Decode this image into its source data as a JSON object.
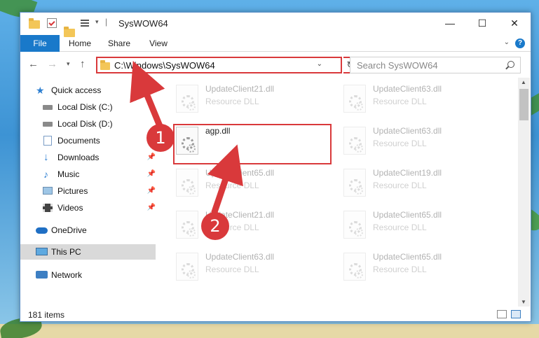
{
  "window": {
    "title": "SysWOW64"
  },
  "window_controls": {
    "minimize": "—",
    "maximize": "☐",
    "close": "✕"
  },
  "ribbon": {
    "tabs": [
      {
        "label": "File",
        "active": true
      },
      {
        "label": "Home"
      },
      {
        "label": "Share"
      },
      {
        "label": "View"
      }
    ],
    "help": "?"
  },
  "address_bar": {
    "path": "C:\\Windows\\SysWOW64",
    "refresh": "↻"
  },
  "search": {
    "placeholder": "Search SysWOW64"
  },
  "sidebar": {
    "items": [
      {
        "label": "Quick access",
        "icon": "star-icon"
      },
      {
        "label": "Local Disk (C:)",
        "icon": "drive-icon"
      },
      {
        "label": "Local Disk (D:)",
        "icon": "drive-icon"
      },
      {
        "label": "Documents",
        "icon": "documents-icon",
        "pinned": true
      },
      {
        "label": "Downloads",
        "icon": "download-icon",
        "pinned": true
      },
      {
        "label": "Music",
        "icon": "music-icon",
        "pinned": true
      },
      {
        "label": "Pictures",
        "icon": "pictures-icon",
        "pinned": true
      },
      {
        "label": "Videos",
        "icon": "videos-icon",
        "pinned": true
      },
      {
        "label": "OneDrive",
        "icon": "cloud-icon"
      },
      {
        "label": "This PC",
        "icon": "computer-icon",
        "selected": true
      },
      {
        "label": "Network",
        "icon": "network-icon"
      }
    ]
  },
  "files": {
    "left": [
      {
        "name": "UpdateClient21.dll",
        "type": "Resource DLL"
      },
      {
        "name": "agp.dll",
        "type": ""
      },
      {
        "name": "UpdateClient65.dll",
        "type": "Resource DLL"
      },
      {
        "name": "UpdateClient21.dll",
        "type": "Resource DLL"
      },
      {
        "name": "UpdateClient63.dll",
        "type": "Resource DLL"
      }
    ],
    "right": [
      {
        "name": "UpdateClient63.dll",
        "type": "Resource DLL"
      },
      {
        "name": "UpdateClient63.dll",
        "type": "Resource DLL"
      },
      {
        "name": "UpdateClient19.dll",
        "type": "Resource DLL"
      },
      {
        "name": "UpdateClient65.dll",
        "type": "Resource DLL"
      },
      {
        "name": "UpdateClient65.dll",
        "type": "Resource DLL"
      }
    ]
  },
  "status": {
    "item_count": "181 items"
  },
  "annotations": {
    "step1": "1",
    "step2": "2",
    "color": "#d9393b"
  }
}
